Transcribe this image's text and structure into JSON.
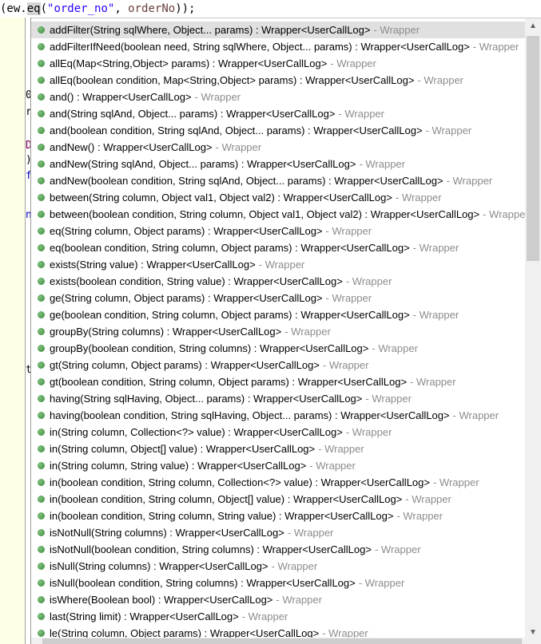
{
  "editor": {
    "code_prefix": "(ew.",
    "code_method": "eq",
    "code_open": "(",
    "code_string": "\"order_no\"",
    "code_sep": ", ",
    "code_var": "orderNo",
    "code_close": "));",
    "strip_chars": [
      "0",
      "r",
      "D",
      ")",
      "f",
      "n",
      "t"
    ]
  },
  "popup": {
    "qualifier": "- Wrapper",
    "items": [
      {
        "sig": "addFilter(String sqlWhere, Object... params) : Wrapper<UserCallLog>"
      },
      {
        "sig": "addFilterIfNeed(boolean need, String sqlWhere, Object... params) : Wrapper<UserCallLog>"
      },
      {
        "sig": "allEq(Map<String,Object> params) : Wrapper<UserCallLog>"
      },
      {
        "sig": "allEq(boolean condition, Map<String,Object> params) : Wrapper<UserCallLog>"
      },
      {
        "sig": "and() : Wrapper<UserCallLog>"
      },
      {
        "sig": "and(String sqlAnd, Object... params) : Wrapper<UserCallLog>"
      },
      {
        "sig": "and(boolean condition, String sqlAnd, Object... params) : Wrapper<UserCallLog>"
      },
      {
        "sig": "andNew() : Wrapper<UserCallLog>"
      },
      {
        "sig": "andNew(String sqlAnd, Object... params) : Wrapper<UserCallLog>"
      },
      {
        "sig": "andNew(boolean condition, String sqlAnd, Object... params) : Wrapper<UserCallLog>"
      },
      {
        "sig": "between(String column, Object val1, Object val2) : Wrapper<UserCallLog>"
      },
      {
        "sig": "between(boolean condition, String column, Object val1, Object val2) : Wrapper<UserCallLog>"
      },
      {
        "sig": "eq(String column, Object params) : Wrapper<UserCallLog>"
      },
      {
        "sig": "eq(boolean condition, String column, Object params) : Wrapper<UserCallLog>"
      },
      {
        "sig": "exists(String value) : Wrapper<UserCallLog>"
      },
      {
        "sig": "exists(boolean condition, String value) : Wrapper<UserCallLog>"
      },
      {
        "sig": "ge(String column, Object params) : Wrapper<UserCallLog>"
      },
      {
        "sig": "ge(boolean condition, String column, Object params) : Wrapper<UserCallLog>"
      },
      {
        "sig": "groupBy(String columns) : Wrapper<UserCallLog>"
      },
      {
        "sig": "groupBy(boolean condition, String columns) : Wrapper<UserCallLog>"
      },
      {
        "sig": "gt(String column, Object params) : Wrapper<UserCallLog>"
      },
      {
        "sig": "gt(boolean condition, String column, Object params) : Wrapper<UserCallLog>"
      },
      {
        "sig": "having(String sqlHaving, Object... params) : Wrapper<UserCallLog>"
      },
      {
        "sig": "having(boolean condition, String sqlHaving, Object... params) : Wrapper<UserCallLog>"
      },
      {
        "sig": "in(String column, Collection<?> value) : Wrapper<UserCallLog>"
      },
      {
        "sig": "in(String column, Object[] value) : Wrapper<UserCallLog>"
      },
      {
        "sig": "in(String column, String value) : Wrapper<UserCallLog>"
      },
      {
        "sig": "in(boolean condition, String column, Collection<?> value) : Wrapper<UserCallLog>"
      },
      {
        "sig": "in(boolean condition, String column, Object[] value) : Wrapper<UserCallLog>"
      },
      {
        "sig": "in(boolean condition, String column, String value) : Wrapper<UserCallLog>"
      },
      {
        "sig": "isNotNull(String columns) : Wrapper<UserCallLog>"
      },
      {
        "sig": "isNotNull(boolean condition, String columns) : Wrapper<UserCallLog>"
      },
      {
        "sig": "isNull(String columns) : Wrapper<UserCallLog>"
      },
      {
        "sig": "isNull(boolean condition, String columns) : Wrapper<UserCallLog>"
      },
      {
        "sig": "isWhere(Boolean bool) : Wrapper<UserCallLog>"
      },
      {
        "sig": "last(String limit) : Wrapper<UserCallLog>"
      },
      {
        "sig": "le(String column, Object params) : Wrapper<UserCallLog>"
      }
    ],
    "selected_index": 0
  },
  "colors": {
    "method_dot": "#3a8a3a",
    "qualifier": "#8c8c8c",
    "selection": "#e0e0e0",
    "tooltip_bg": "#ffffe6"
  }
}
